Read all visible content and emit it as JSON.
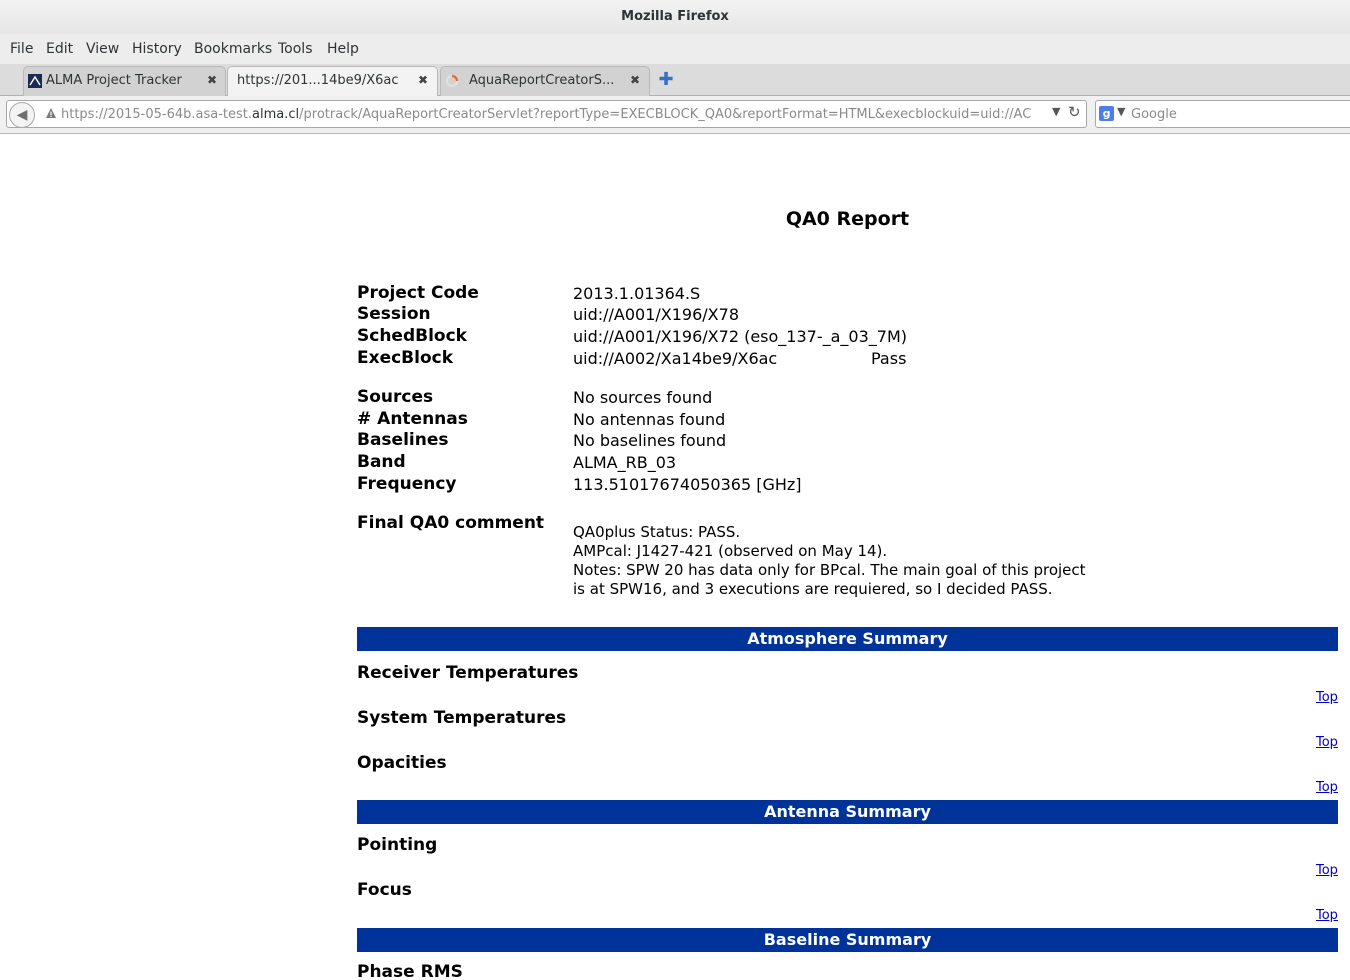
{
  "window": {
    "title": "Mozilla Firefox"
  },
  "menu": [
    "File",
    "Edit",
    "View",
    "History",
    "Bookmarks",
    "Tools",
    "Help"
  ],
  "tabs": [
    {
      "label": "ALMA Project Tracker",
      "active": false,
      "icon": "alma-favicon"
    },
    {
      "label": "https://201...14be9/X6ac",
      "active": true,
      "icon": "none"
    },
    {
      "label": "AquaReportCreatorS...",
      "active": false,
      "icon": "loading-spinner"
    }
  ],
  "navbar": {
    "url_prefix": "https://2015-05-64b.asa-test.",
    "url_domain": "alma.cl",
    "url_suffix": "/protrack/AquaReportCreatorServlet?reportType=EXECBLOCK_QA0&reportFormat=HTML&execblockuid=uid://AC",
    "search_placeholder": "Google"
  },
  "report": {
    "title": "QA0 Report",
    "fields_top": [
      {
        "label": "Project Code",
        "value": "2013.1.01364.S"
      },
      {
        "label": "Session",
        "value": "uid://A001/X196/X78"
      },
      {
        "label": "SchedBlock",
        "value": "uid://A001/X196/X72 (eso_137-_a_03_7M)"
      },
      {
        "label": "ExecBlock",
        "value": "uid://A002/Xa14be9/X6ac",
        "status": "Pass"
      }
    ],
    "fields_mid": [
      {
        "label": "Sources",
        "value": "No sources found"
      },
      {
        "label": "# Antennas",
        "value": "No antennas found"
      },
      {
        "label": "Baselines",
        "value": "No baselines found"
      },
      {
        "label": "Band",
        "value": "ALMA_RB_03"
      },
      {
        "label": "Frequency",
        "value": "113.51017674050365 [GHz]"
      }
    ],
    "comment_label": "Final QA0 comment",
    "comment_lines": [
      "QA0plus Status: PASS.",
      "AMPcal: J1427-421 (observed on May 14).",
      "Notes: SPW 20 has data only for BPcal. The main goal of this project",
      "is at SPW16, and 3 executions are requiered, so I decided PASS."
    ],
    "sections": [
      {
        "title": "Atmosphere Summary",
        "items": [
          "Receiver Temperatures",
          "System Temperatures",
          "Opacities"
        ]
      },
      {
        "title": "Antenna Summary",
        "items": [
          "Pointing",
          "Focus"
        ]
      },
      {
        "title": "Baseline Summary",
        "items": [
          "Phase RMS"
        ]
      }
    ],
    "top_link": "Top"
  },
  "colors": {
    "section_bg": "#003399",
    "link": "#0000cc"
  }
}
